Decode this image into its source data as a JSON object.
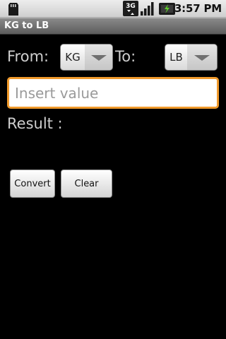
{
  "status_bar": {
    "time": "3:57 PM",
    "icons": [
      "sd-card-icon",
      "3g-data-icon",
      "signal-icon",
      "battery-icon"
    ],
    "network_label": "3G"
  },
  "app": {
    "title": "KG to LB"
  },
  "converter": {
    "from_label": "From:",
    "to_label": "To:",
    "from_unit": "KG",
    "to_unit": "LB",
    "input_placeholder": "Insert value",
    "input_value": "",
    "result_label": "Result :",
    "result_value": ""
  },
  "buttons": {
    "convert": "Convert",
    "clear": "Clear"
  },
  "colors": {
    "background": "#000000",
    "focus_border": "#f09a2c",
    "titlebar": "#6e6e6e",
    "label_text": "#cfcfcf"
  }
}
